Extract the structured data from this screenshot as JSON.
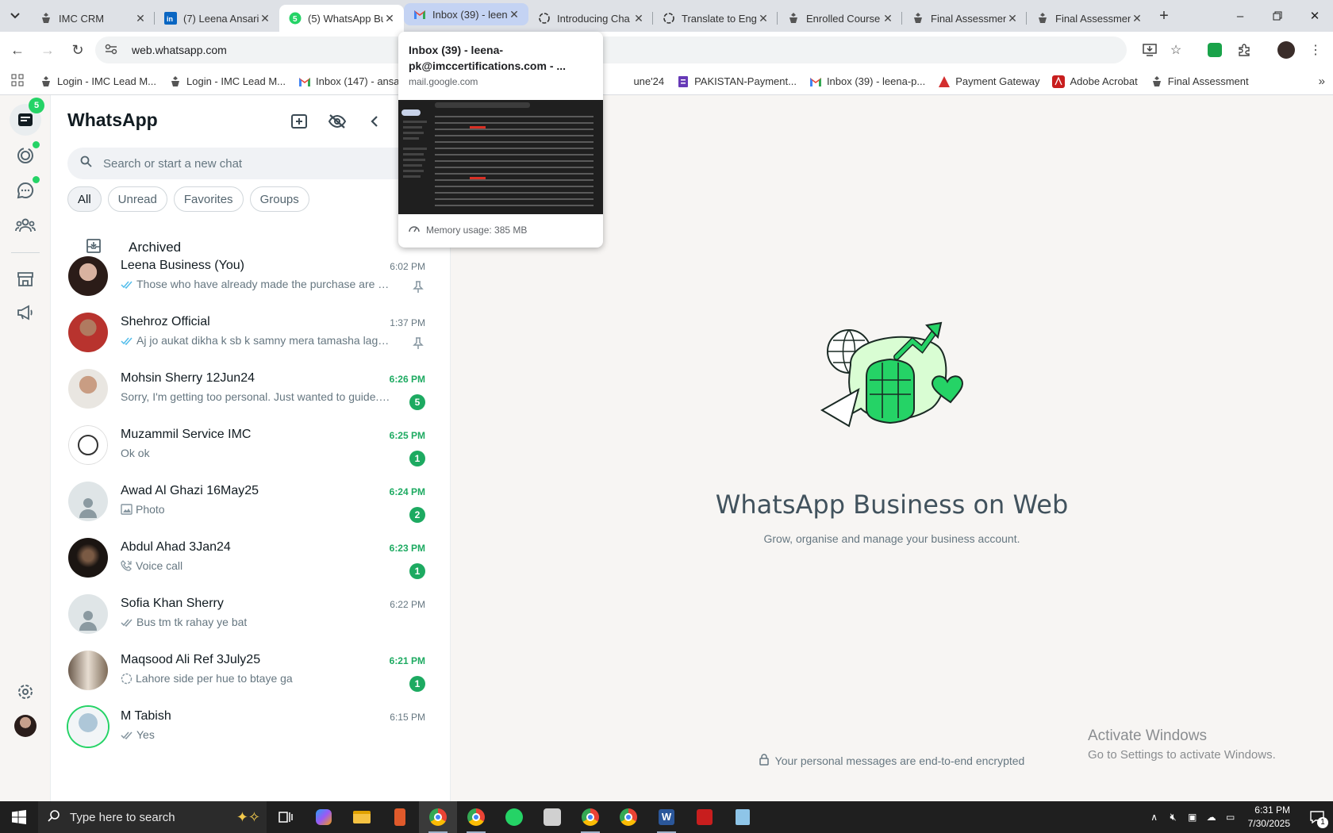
{
  "tabs": [
    {
      "title": "IMC CRM",
      "icon": "imc-icon"
    },
    {
      "title": "(7) Leena Ansari",
      "icon": "linkedin-icon"
    },
    {
      "title": "(5) WhatsApp Bu",
      "icon": "whatsapp-icon",
      "badge": "5"
    },
    {
      "title": "Inbox (39) - leen",
      "icon": "gmail-icon"
    },
    {
      "title": "Introducing Cha",
      "icon": "openai-icon"
    },
    {
      "title": "Translate to Engl",
      "icon": "openai-icon"
    },
    {
      "title": "Enrolled Course",
      "icon": "imc-icon"
    },
    {
      "title": "Final Assessmen",
      "icon": "imc-icon"
    },
    {
      "title": "Final Assessmen",
      "icon": "imc-icon"
    }
  ],
  "address": {
    "url": "web.whatsapp.com"
  },
  "bookmarks": [
    {
      "label": "Login - IMC Lead M...",
      "icon": "imc-icon"
    },
    {
      "label": "Login - IMC Lead M...",
      "icon": "imc-icon"
    },
    {
      "label": "Inbox (147) - ansaril...",
      "icon": "gmail-icon"
    },
    {
      "label": "une'24",
      "icon": ""
    },
    {
      "label": "PAKISTAN-Payment...",
      "icon": "form-icon"
    },
    {
      "label": "Inbox (39) - leena-p...",
      "icon": "gmail-icon"
    },
    {
      "label": "Payment Gateway",
      "icon": "pg-icon"
    },
    {
      "label": "Adobe Acrobat",
      "icon": "acrobat-icon"
    },
    {
      "label": "Final Assessment",
      "icon": "imc-icon"
    }
  ],
  "hovercard": {
    "title": "Inbox (39) - leena-pk@imccertifications.com - ...",
    "domain": "mail.google.com",
    "memory": "Memory usage: 385 MB"
  },
  "rail": {
    "chats_badge": "5"
  },
  "sidebar": {
    "title": "WhatsApp",
    "search_placeholder": "Search or start a new chat",
    "filters": [
      "All",
      "Unread",
      "Favorites",
      "Groups"
    ],
    "archived_label": "Archived"
  },
  "chats": [
    {
      "name": "Leena Business (You)",
      "time": "6:02 PM",
      "preview": "Those who have already made the purchase are goo...",
      "status": "read",
      "pinned": true,
      "avatar": "photo-woman"
    },
    {
      "name": "Shehroz Official",
      "time": "1:37 PM",
      "preview": "Aj jo aukat dikha k sb k samny mera tamasha lagay...",
      "status": "read",
      "pinned": true,
      "avatar": "photo-man-red"
    },
    {
      "name": "Mohsin Sherry 12Jun24",
      "time": "6:26 PM",
      "preview": "Sorry, I'm getting too personal. Just wanted to guide.. I ...",
      "unread": "5",
      "avatar": "photo-man"
    },
    {
      "name": "Muzammil Service IMC",
      "time": "6:25 PM",
      "preview": "Ok ok",
      "unread": "1",
      "avatar": "logo-imc"
    },
    {
      "name": "Awad Al Ghazi 16May25",
      "time": "6:24 PM",
      "preview": "Photo",
      "status": "photo",
      "unread": "2",
      "avatar": "default"
    },
    {
      "name": "Abdul Ahad 3Jan24",
      "time": "6:23 PM",
      "preview": "Voice call",
      "status": "call",
      "unread": "1",
      "avatar": "photo-dark"
    },
    {
      "name": "Sofia Khan Sherry",
      "time": "6:22 PM",
      "preview": "Bus tm tk rahay ye bat",
      "status": "delivered",
      "avatar": "default"
    },
    {
      "name": "Maqsood Ali Ref 3July25",
      "time": "6:21 PM",
      "preview": "Lahore side per hue to btaye ga",
      "status": "pending",
      "unread": "1",
      "avatar": "photo-group"
    },
    {
      "name": "M Tabish",
      "time": "6:15 PM",
      "preview": "Yes",
      "status": "delivered",
      "avatar": "photo-man-ring"
    }
  ],
  "main": {
    "title": "WhatsApp Business on Web",
    "subtitle": "Grow, organise and manage your business account.",
    "encrypted": "Your personal messages are end-to-end encrypted"
  },
  "watermark": {
    "line1": "Activate Windows",
    "line2": "Go to Settings to activate Windows."
  },
  "taskbar": {
    "search_placeholder": "Type here to search",
    "time": "6:31 PM",
    "date": "7/30/2025",
    "notifications": "1"
  }
}
